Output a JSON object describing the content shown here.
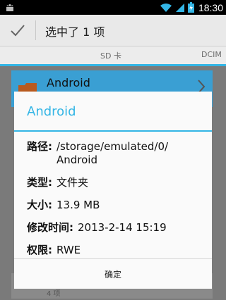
{
  "statusbar": {
    "time": "18:30"
  },
  "actionbar": {
    "title": "选中了 1 项"
  },
  "tabs": [
    {
      "label": "SD 卡"
    },
    {
      "label": "DCIM"
    }
  ],
  "list": {
    "selected_item": "Android",
    "faint_count": "4 项"
  },
  "dialog": {
    "title": "Android",
    "properties": [
      {
        "key": "路径:",
        "value": "/storage/emulated/0/\nAndroid"
      },
      {
        "key": "类型:",
        "value": "文件夹"
      },
      {
        "key": "大小:",
        "value": "13.9 MB"
      },
      {
        "key": "修改时间:",
        "value": "2013-2-14 15:19"
      },
      {
        "key": "权限:",
        "value": "RWE"
      }
    ],
    "ok_label": "确定"
  },
  "colors": {
    "accent": "#33b5e5",
    "selected": "#3a9fd3"
  }
}
